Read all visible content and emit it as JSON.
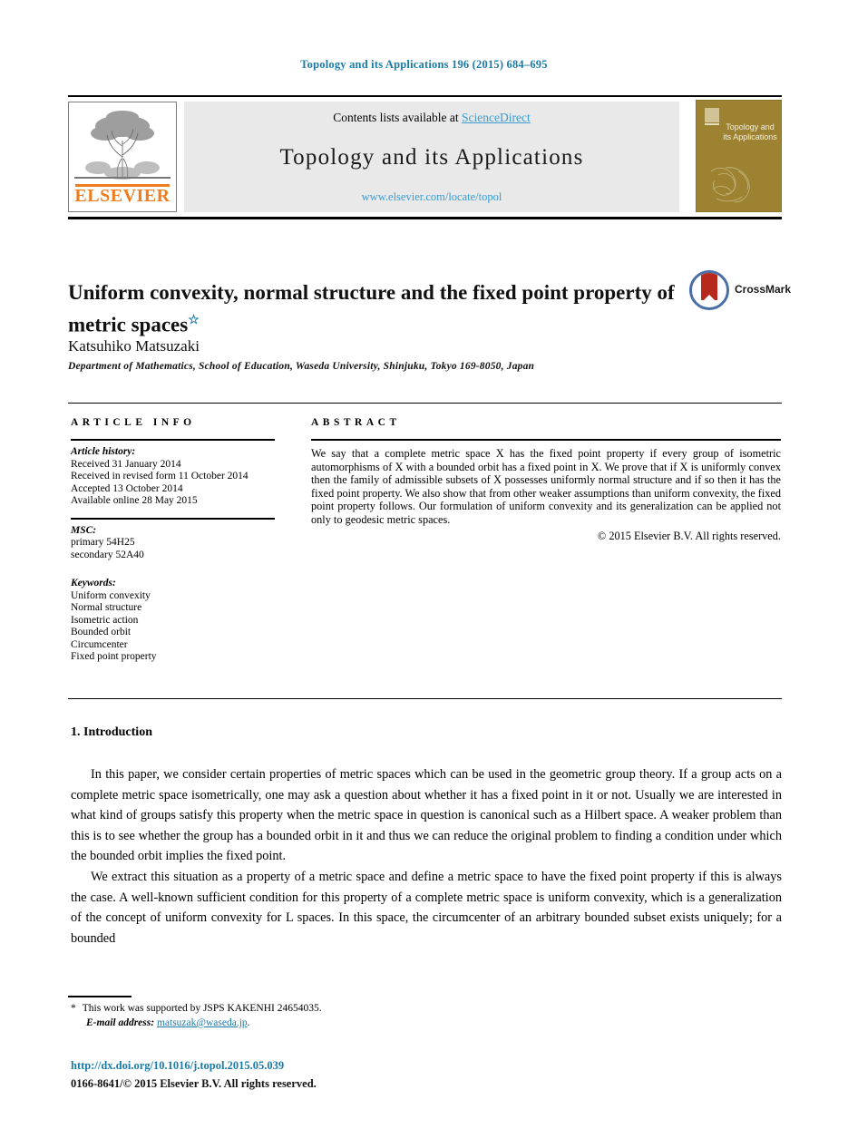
{
  "running_head": "Topology and its Applications 196 (2015) 684–695",
  "masthead": {
    "contents_prefix": "Contents lists available at ",
    "sciencedirect": "ScienceDirect",
    "journal_title": "Topology and its Applications",
    "journal_url": "www.elsevier.com/locate/topol",
    "publisher": "ELSEVIER",
    "cover_title": "Topology and its Applications"
  },
  "article": {
    "title": "Uniform convexity, normal structure and the fixed point property of metric spaces",
    "title_footnote_mark": "☆",
    "author": "Katsuhiko Matsuzaki",
    "affiliation": "Department of Mathematics, School of Education, Waseda University, Shinjuku, Tokyo 169-8050, Japan",
    "crossmark_label": "CrossMark"
  },
  "info": {
    "heading": "ARTICLE INFO",
    "history_label": "Article history:",
    "history": [
      "Received 31 January 2014",
      "Received in revised form 11 October 2014",
      "Accepted 13 October 2014",
      "Available online 28 May 2015"
    ],
    "msc_label": "MSC:",
    "msc": [
      "primary 54H25",
      "secondary 52A40"
    ],
    "keywords_label": "Keywords:",
    "keywords": [
      "Uniform convexity",
      "Normal structure",
      "Isometric action",
      "Bounded orbit",
      "Circumcenter",
      "Fixed point property"
    ]
  },
  "abstract": {
    "heading": "ABSTRACT",
    "body": "We say that a complete metric space X has the fixed point property if every group of isometric automorphisms of X with a bounded orbit has a fixed point in X. We prove that if X is uniformly convex then the family of admissible subsets of X possesses uniformly normal structure and if so then it has the fixed point property. We also show that from other weaker assumptions than uniform convexity, the fixed point property follows. Our formulation of uniform convexity and its generalization can be applied not only to geodesic metric spaces.",
    "copyright": "© 2015 Elsevier B.V. All rights reserved."
  },
  "section": {
    "heading": "1. Introduction",
    "paragraph_1": "In this paper, we consider certain properties of metric spaces which can be used in the geometric group theory. If a group acts on a complete metric space isometrically, one may ask a question about whether it has a fixed point in it or not. Usually we are interested in what kind of groups satisfy this property when the metric space in question is canonical such as a Hilbert space. A weaker problem than this is to see whether the group has a bounded orbit in it and thus we can reduce the original problem to finding a condition under which the bounded orbit implies the fixed point.",
    "paragraph_2": "We extract this situation as a property of a metric space and define a metric space to have the fixed point property if this is always the case. A well-known sufficient condition for this property of a complete metric space is uniform convexity, which is a generalization of the concept of uniform convexity for L spaces. In this space, the circumcenter of an arbitrary bounded subset exists uniquely; for a bounded"
  },
  "footer": {
    "star": "*",
    "funding": "This work was supported by JSPS KAKENHI 24654035.",
    "email_label": "E-mail address:",
    "email": "matsuzak@waseda.jp",
    "email_period": ".",
    "doi": "http://dx.doi.org/10.1016/j.topol.2015.05.039",
    "issn_line": "0166-8641/© 2015 Elsevier B.V. All rights reserved."
  },
  "colors": {
    "link_blue": "#1a7aa8",
    "sciencedirect_blue": "#3c9bd0",
    "elsevier_orange": "#ef7d20",
    "cover_gold": "#9d8331",
    "crossmark_red": "#b8291d"
  }
}
